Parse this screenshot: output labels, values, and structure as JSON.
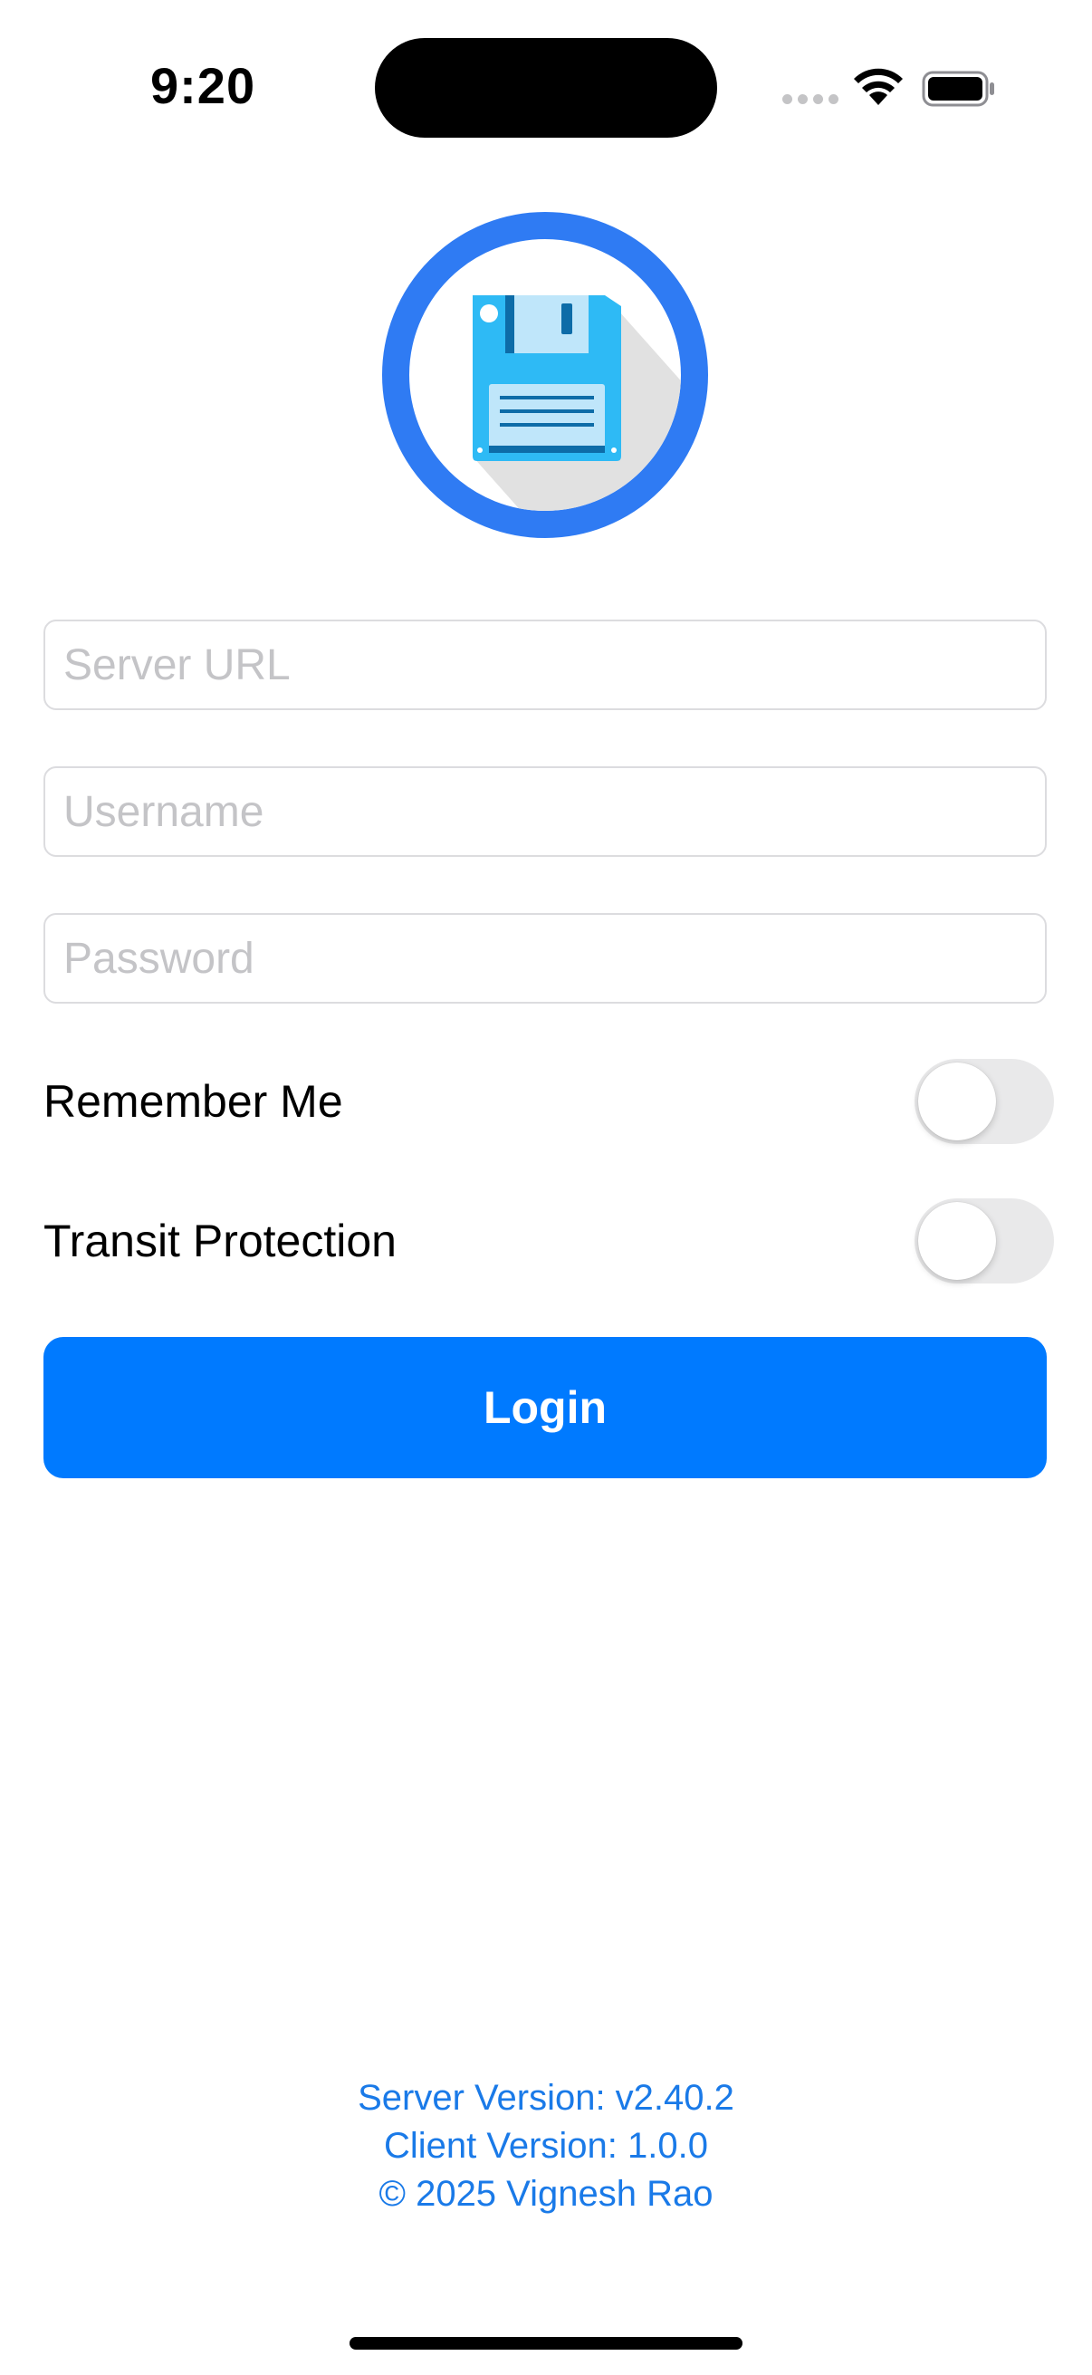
{
  "status_bar": {
    "time": "9:20"
  },
  "colors": {
    "accent": "#007aff",
    "logo_ring": "#2f7bf3",
    "footer_text": "#1a7ae8",
    "toggle_off": "#e9e9ea"
  },
  "logo": {
    "icon": "floppy-disk-icon"
  },
  "form": {
    "server_url": {
      "placeholder": "Server URL",
      "value": ""
    },
    "username": {
      "placeholder": "Username",
      "value": ""
    },
    "password": {
      "placeholder": "Password",
      "value": ""
    },
    "remember_me": {
      "label": "Remember Me",
      "on": false
    },
    "transit_protection": {
      "label": "Transit Protection",
      "on": false
    },
    "login_label": "Login"
  },
  "footer": {
    "server_version": "Server Version: v2.40.2",
    "client_version": "Client Version: 1.0.0",
    "copyright": "© 2025 Vignesh Rao"
  }
}
